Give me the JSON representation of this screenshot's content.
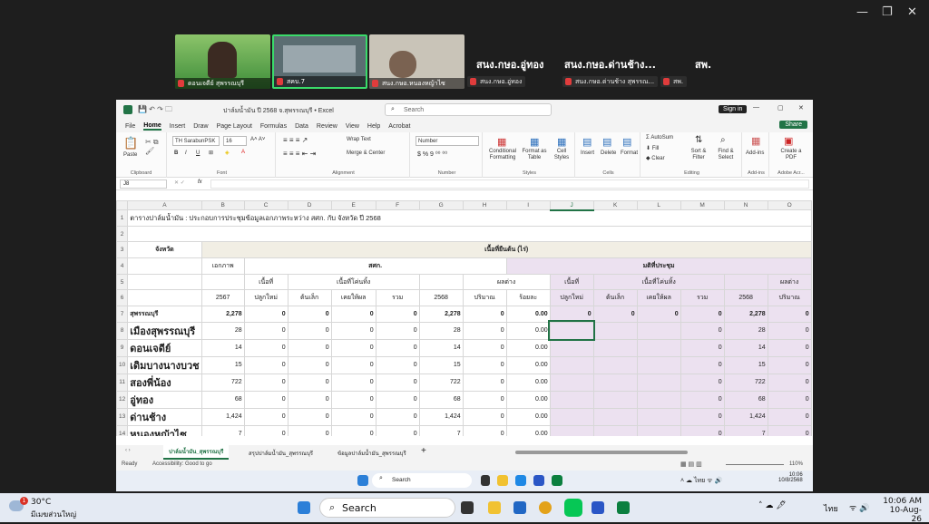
{
  "meeting": {
    "tiles": [
      {
        "name": "ดอนเจดีย์ สุพรรณบุรี"
      },
      {
        "name": "สคบ.7"
      },
      {
        "name": "สนง.กษอ.หนองหญ้าไซ"
      },
      {
        "name": "สนง.กษอ.อู่ทอง"
      }
    ],
    "big_names": [
      "สนง.กษอ.อู่ทอง",
      "สนง.กษอ.ด่านช้าง...",
      "สพ."
    ],
    "pills": [
      "สนง.กษอ.อู่ทอง",
      "สนง.กษอ.ด่านช้าง สุพรรณ...",
      "สพ."
    ]
  },
  "excel": {
    "title": "ปาล์มน้ำมัน ปี 2568 จ.สุพรรณบุรี • Excel",
    "search_placeholder": "Search",
    "signin": "Sign in",
    "tabs": [
      "File",
      "Home",
      "Insert",
      "Draw",
      "Page Layout",
      "Formulas",
      "Data",
      "Review",
      "View",
      "Help",
      "Acrobat"
    ],
    "share": "Share",
    "ribbon": {
      "paste": "Paste",
      "clipboard": "Clipboard",
      "font_name": "TH SarabunPSK",
      "font_size": "16",
      "font": "Font",
      "wrap_text": "Wrap Text",
      "merge_center": "Merge & Center",
      "alignment": "Alignment",
      "number_format": "Number",
      "number": "Number",
      "conditional": "Conditional Formatting",
      "format_as_table": "Format as Table",
      "cell_styles": "Cell Styles",
      "styles": "Styles",
      "insert": "Insert",
      "delete": "Delete",
      "format": "Format",
      "cells": "Cells",
      "autosum": "AutoSum",
      "fill": "Fill",
      "clear": "Clear",
      "sort_filter": "Sort & Filter",
      "find_select": "Find & Select",
      "editing": "Editing",
      "addins": "Add-ins",
      "addins_group": "Add-ins",
      "create_pdf": "Create a PDF",
      "adobe": "Adobe Acr..."
    },
    "name_box": "J8",
    "fx": "fx",
    "columns": [
      "A",
      "B",
      "C",
      "D",
      "E",
      "F",
      "G",
      "H",
      "I",
      "J",
      "K",
      "L",
      "M",
      "N",
      "O"
    ],
    "row1_title": "ตารางปาล์มน้ำมัน : ประกอบการประชุมข้อมูลเอกภาพระหว่าง สศก. กับ จังหวัด ปี 2568",
    "hdr": {
      "province": "จังหวัด",
      "area": "เนื้อที่ยืนต้น  (ไร่)",
      "unity": "เอกภาพ",
      "oae": "สศก.",
      "meeting": "มติที่ประชุม",
      "new_area": "เนื้อที่",
      "new_area2": "ปลูกใหม่",
      "abandoned": "เนื้อที่โค่นทิ้ง",
      "diff": "ผลต่าง",
      "y2567": "2567",
      "y2568": "2568",
      "small": "ต้นเล็ก",
      "old": "เคยให้ผล",
      "total": "รวม",
      "qty": "ปริมาณ",
      "pct": "ร้อยละ"
    },
    "rows": [
      {
        "num": "7",
        "name": "สุพรรณบุรี",
        "b": "2,278",
        "c": "0",
        "d": "0",
        "e": "0",
        "f": "0",
        "g": "2,278",
        "h": "0",
        "i": "0.00",
        "j": "0",
        "k": "0",
        "l": "0",
        "m": "0",
        "n": "2,278",
        "o": "0"
      },
      {
        "num": "8",
        "name": "เมืองสุพรรณบุรี",
        "b": "28",
        "c": "0",
        "d": "0",
        "e": "0",
        "f": "0",
        "g": "28",
        "h": "0",
        "i": "0.00",
        "j": "",
        "k": "",
        "l": "",
        "m": "0",
        "n": "28",
        "o": "0"
      },
      {
        "num": "9",
        "name": "ดอนเจดีย์",
        "b": "14",
        "c": "0",
        "d": "0",
        "e": "0",
        "f": "0",
        "g": "14",
        "h": "0",
        "i": "0.00",
        "j": "",
        "k": "",
        "l": "",
        "m": "0",
        "n": "14",
        "o": "0"
      },
      {
        "num": "10",
        "name": "เดิมบางนางบวช",
        "b": "15",
        "c": "0",
        "d": "0",
        "e": "0",
        "f": "0",
        "g": "15",
        "h": "0",
        "i": "0.00",
        "j": "",
        "k": "",
        "l": "",
        "m": "0",
        "n": "15",
        "o": "0"
      },
      {
        "num": "11",
        "name": "สองพี่น้อง",
        "b": "722",
        "c": "0",
        "d": "0",
        "e": "0",
        "f": "0",
        "g": "722",
        "h": "0",
        "i": "0.00",
        "j": "",
        "k": "",
        "l": "",
        "m": "0",
        "n": "722",
        "o": "0"
      },
      {
        "num": "12",
        "name": "อู่ทอง",
        "b": "68",
        "c": "0",
        "d": "0",
        "e": "0",
        "f": "0",
        "g": "68",
        "h": "0",
        "i": "0.00",
        "j": "",
        "k": "",
        "l": "",
        "m": "0",
        "n": "68",
        "o": "0"
      },
      {
        "num": "13",
        "name": "ด่านช้าง",
        "b": "1,424",
        "c": "0",
        "d": "0",
        "e": "0",
        "f": "0",
        "g": "1,424",
        "h": "0",
        "i": "0.00",
        "j": "",
        "k": "",
        "l": "",
        "m": "0",
        "n": "1,424",
        "o": "0"
      },
      {
        "num": "14",
        "name": "หนองหญ้าไซ",
        "b": "7",
        "c": "0",
        "d": "0",
        "e": "0",
        "f": "0",
        "g": "7",
        "h": "0",
        "i": "0.00",
        "j": "",
        "k": "",
        "l": "",
        "m": "0",
        "n": "7",
        "o": "0"
      }
    ],
    "sheet_tabs": [
      "ปาล์มน้ำมัน_สุพรรณบุรี",
      "สรุปปาล์มน้ำมัน_สุพรรณบุรี",
      "ข้อมูลปาล์มน้ำมัน_สุพรรณบุรี"
    ],
    "status_ready": "Ready",
    "status_access": "Accessibility: Good to go",
    "zoom": "110%",
    "inner_search": "Search",
    "inner_time": "10:06",
    "inner_date": "10/8/2568"
  },
  "taskbar": {
    "weather_temp": "30°C",
    "weather_desc": "มีเมฆส่วนใหญ่",
    "badge": "1",
    "search": "Search",
    "lang": "ไทย",
    "time": "10:06 AM",
    "date": "10-Aug-26"
  }
}
